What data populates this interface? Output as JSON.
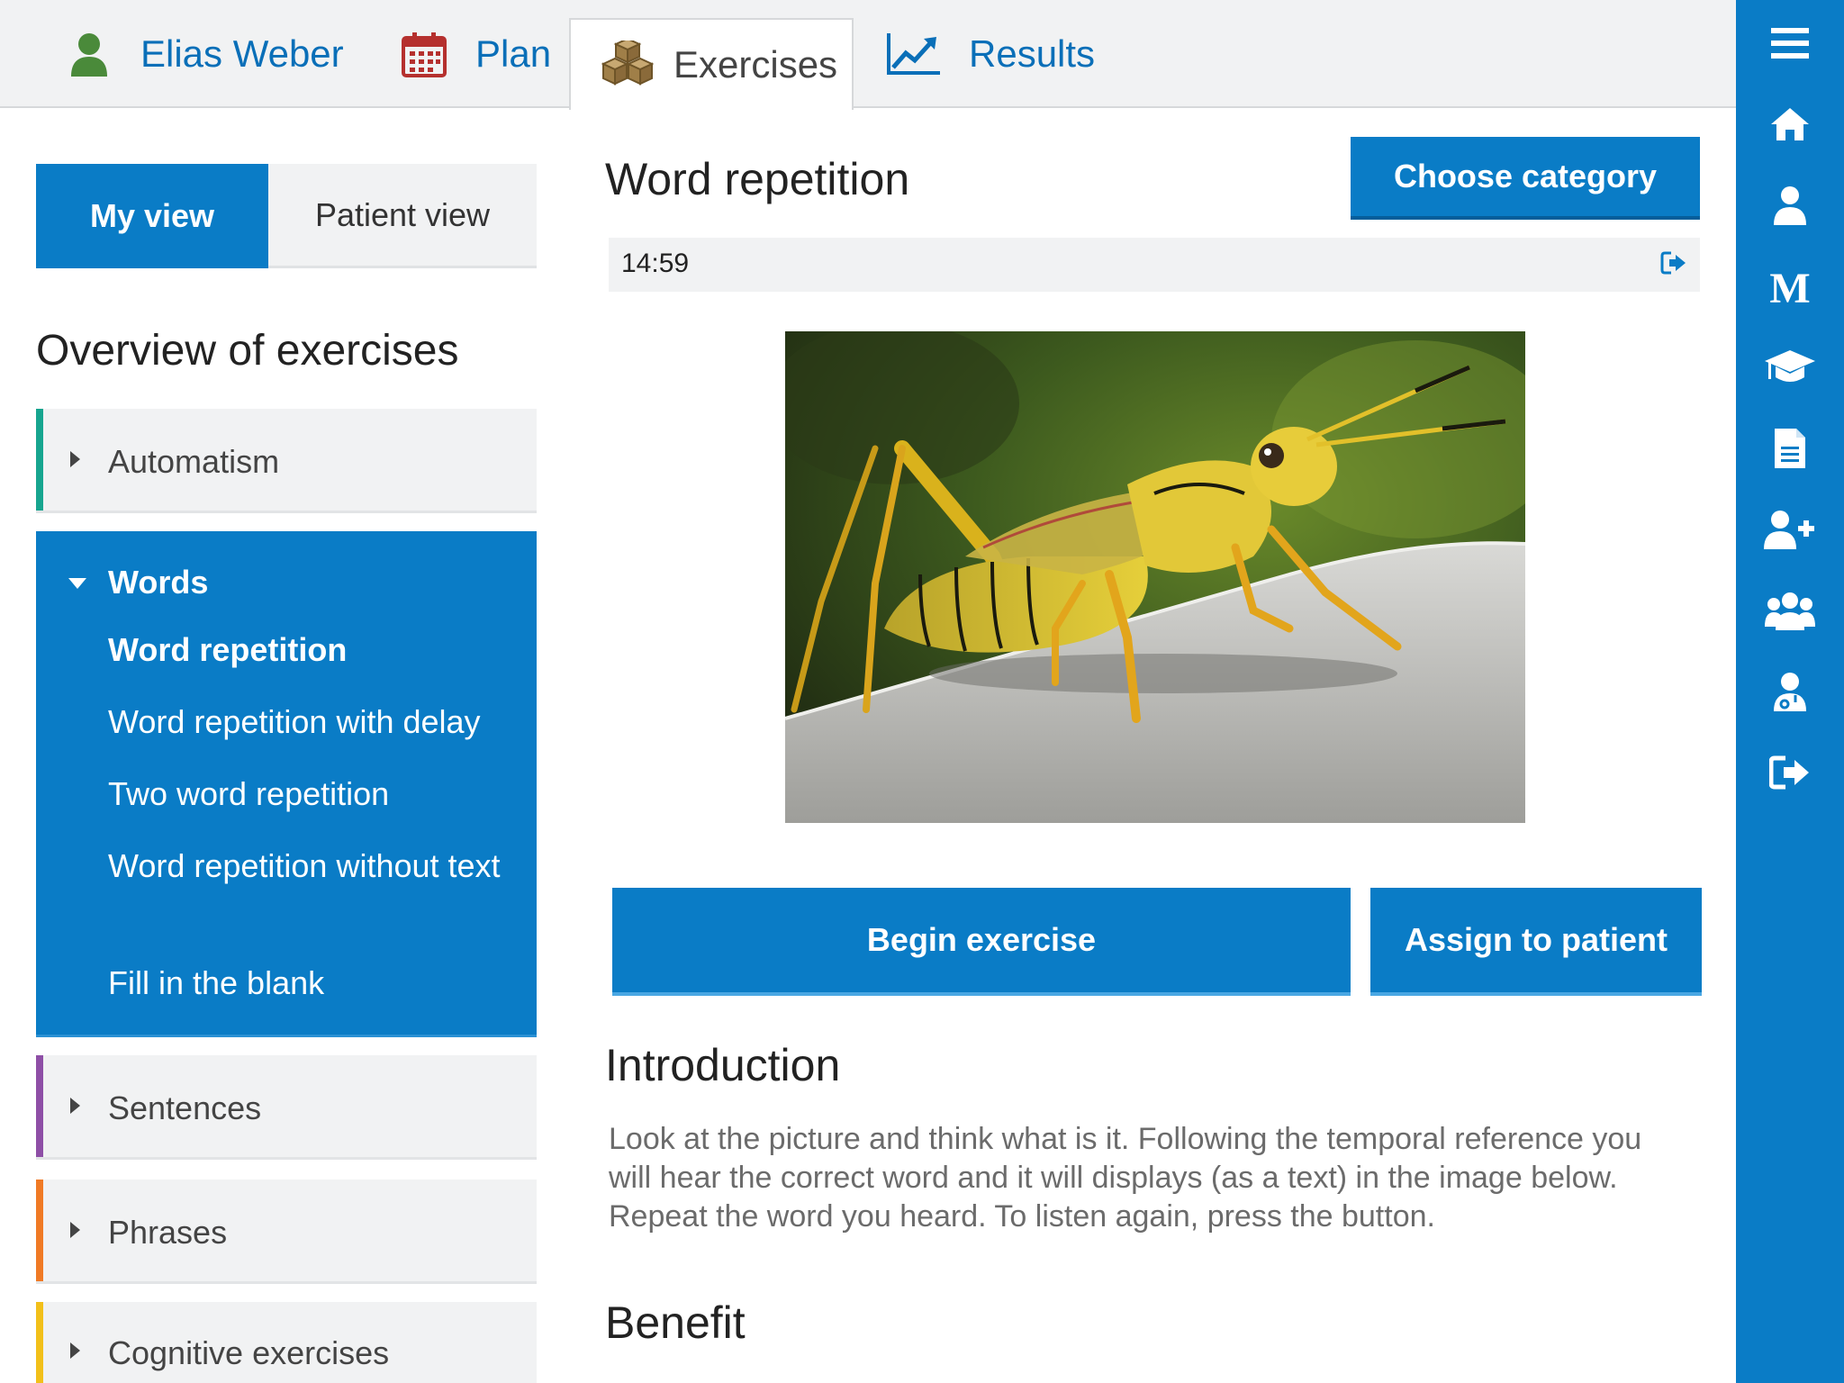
{
  "tabs": {
    "user": "Elias Weber",
    "plan": "Plan",
    "exercises": "Exercises",
    "results": "Results"
  },
  "view_toggle": {
    "my_view": "My view",
    "patient_view": "Patient view"
  },
  "overview": {
    "title": "Overview of exercises",
    "categories": [
      {
        "label": "Automatism",
        "color": "#17a58f"
      },
      {
        "label": "Words",
        "color": "#0a7cc6",
        "expanded": true,
        "items": [
          "Word repetition",
          "Word repetition with delay",
          "Two word repetition",
          "Word repetition without text",
          "Fill in the blank"
        ],
        "active_item": "Word repetition"
      },
      {
        "label": "Sentences",
        "color": "#8e4fa6"
      },
      {
        "label": "Phrases",
        "color": "#f07a25"
      },
      {
        "label": "Cognitive exercises",
        "color": "#f2c01a"
      }
    ]
  },
  "exercise": {
    "title": "Word repetition",
    "choose_category": "Choose category",
    "timer": "14:59",
    "image_subject": "grasshopper",
    "begin": "Begin exercise",
    "assign": "Assign to patient",
    "introduction_heading": "Introduction",
    "introduction_text": "Look at the picture and think what is it. Following the temporal reference you will hear the correct word and it will displays (as a text) in the image below. Repeat the word you heard. To listen again, press the button.",
    "benefit_heading": "Benefit"
  },
  "sidebar_icons": [
    "menu-icon",
    "home-icon",
    "user-icon",
    "m-icon",
    "graduation-cap-icon",
    "document-icon",
    "add-user-icon",
    "group-icon",
    "doctor-icon",
    "sign-out-icon"
  ],
  "colors": {
    "primary": "#0a7cc6",
    "tab_text": "#0a6fb8",
    "user_icon": "#4a8a3a",
    "calendar_icon": "#b5302e",
    "cubes_icon": "#8a6a3a"
  }
}
